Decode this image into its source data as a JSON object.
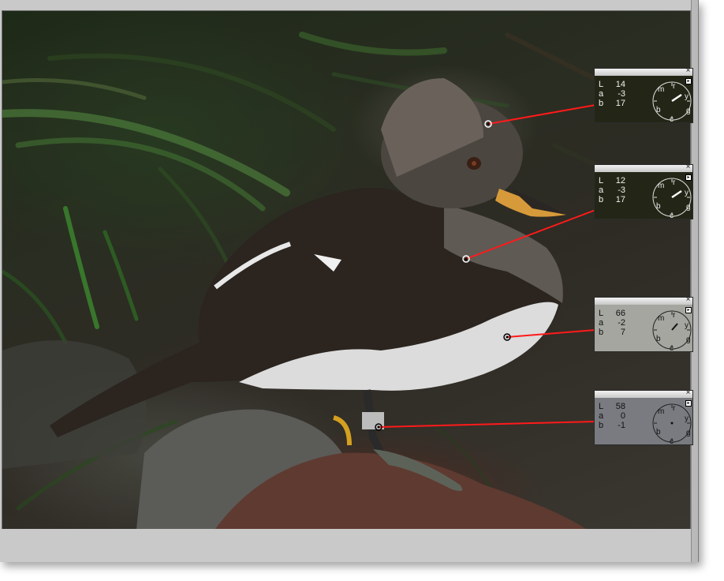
{
  "window": {
    "accent": "#c9c9c9",
    "line_color": "#ff1a1a"
  },
  "photo": {
    "subject": "hooded merganser duck standing on a rock"
  },
  "probes": [
    {
      "id": "probe-1",
      "L_label": "L",
      "L_value": "14",
      "a_label": "a",
      "a_value": "-3",
      "b_label": "b",
      "b_value": "17",
      "close": "×",
      "dial": {
        "m": "m",
        "r": "r",
        "y": "y",
        "g": "g",
        "c": "c",
        "b": "b"
      }
    },
    {
      "id": "probe-2",
      "L_label": "L",
      "L_value": "12",
      "a_label": "a",
      "a_value": "-3",
      "b_label": "b",
      "b_value": "17",
      "close": "×",
      "dial": {
        "m": "m",
        "r": "r",
        "y": "y",
        "g": "g",
        "c": "c",
        "b": "b"
      }
    },
    {
      "id": "probe-3",
      "L_label": "L",
      "L_value": "66",
      "a_label": "a",
      "a_value": "-2",
      "b_label": "b",
      "b_value": "7",
      "close": "×",
      "dial": {
        "m": "m",
        "r": "r",
        "y": "y",
        "g": "g",
        "c": "c",
        "b": "b"
      }
    },
    {
      "id": "probe-4",
      "L_label": "L",
      "L_value": "58",
      "a_label": "a",
      "a_value": "0",
      "b_label": "b",
      "b_value": "-1",
      "close": "×",
      "dial": {
        "m": "m",
        "r": "r",
        "y": "y",
        "g": "g",
        "c": "c",
        "b": "b"
      }
    }
  ]
}
